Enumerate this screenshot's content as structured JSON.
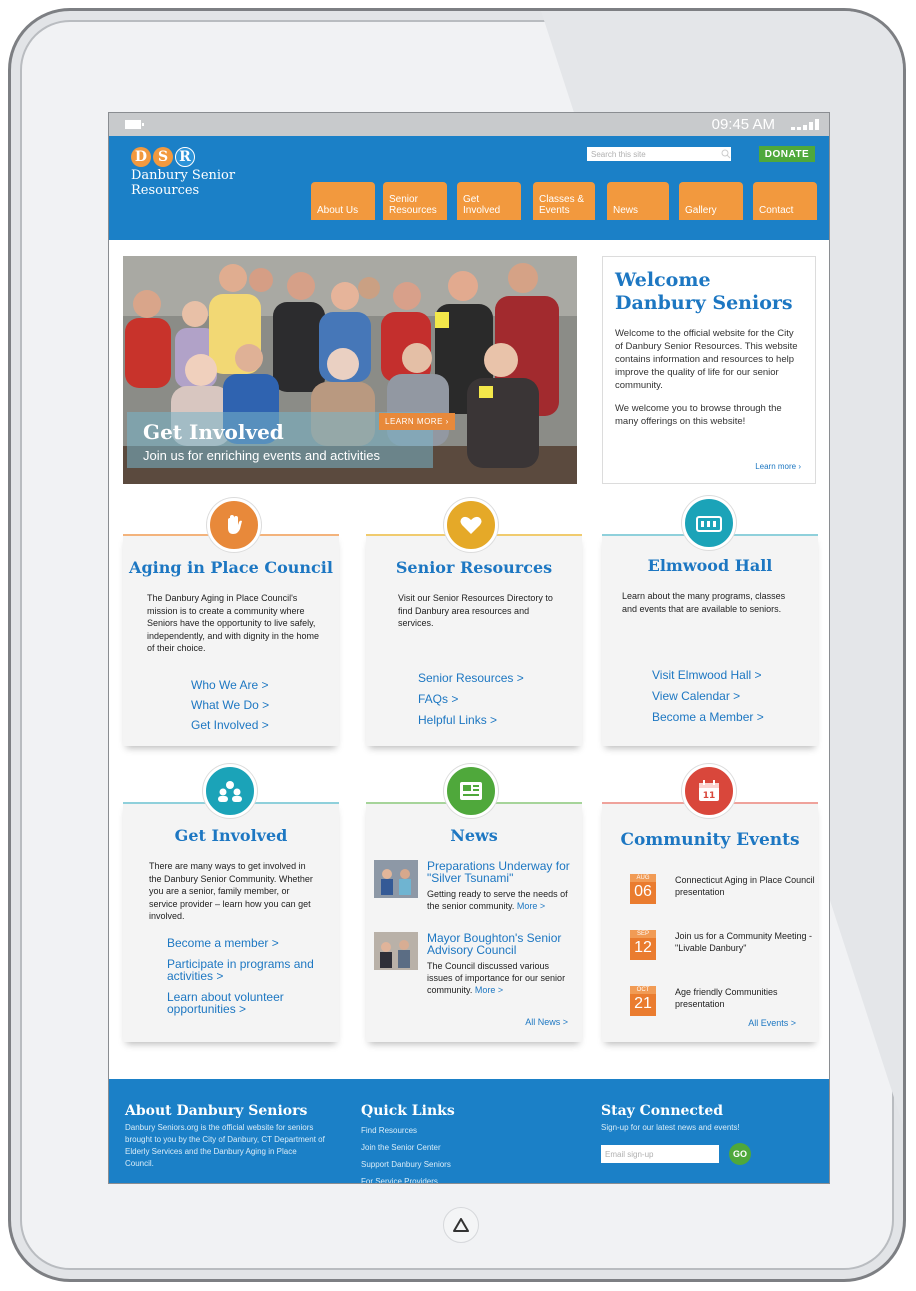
{
  "status_bar": {
    "time": "09:45 AM"
  },
  "logo": {
    "letters": [
      "D",
      "S",
      "R"
    ],
    "name_line1": "Danbury Senior",
    "name_line2": "Resources",
    "colors": [
      "#f2993e",
      "#f2993e",
      "#1b80c7"
    ]
  },
  "search": {
    "placeholder": "Search this site"
  },
  "donate_label": "DONATE",
  "nav": [
    {
      "label": "About Us"
    },
    {
      "label": "Senior Resources"
    },
    {
      "label": "Get Involved"
    },
    {
      "label": "Classes & Events"
    },
    {
      "label": "News"
    },
    {
      "label": "Gallery"
    },
    {
      "label": "Contact"
    }
  ],
  "hero": {
    "title": "Get Involved",
    "subtitle": "Join us for enriching events and activities",
    "button": "LEARN MORE ›"
  },
  "welcome": {
    "title": "Welcome Danbury Seniors",
    "p1": "Welcome to the official website for the City of Danbury Senior Resources. This website contains information and resources to help improve the quality of life for our senior community.",
    "p2": "We welcome you to browse through the many offerings on this website!",
    "link": "Learn more ›"
  },
  "cards": {
    "aging": {
      "title": "Aging in Place Council",
      "body": "The Danbury Aging in Place Council's mission is to create a community where Seniors  have the opportunity to live safely, independently, and with dignity in the home of their choice.",
      "links": [
        "Who We Are >",
        "What We Do >",
        "Get Involved >"
      ],
      "icon": "hand-icon",
      "color": "#e8893a"
    },
    "resources": {
      "title": "Senior Resources",
      "body": "Visit our Senior Resources Directory to find Danbury area resources and services.",
      "links": [
        "Senior Resources >",
        "FAQs >",
        "Helpful Links >"
      ],
      "icon": "heart-icon",
      "color": "#e5a928"
    },
    "elmwood": {
      "title": "Elmwood Hall",
      "body": "Learn about the many programs, classes and events that are available to seniors.",
      "links": [
        "Visit Elmwood Hall >",
        "View Calendar >",
        "Become a Member >"
      ],
      "icon": "building-icon",
      "color": "#1ba3b8"
    },
    "involved": {
      "title": "Get Involved",
      "body": "There are many ways to get involved in the Danbury Senior Community. Whether you are a senior, family member, or service provider – learn how you can get involved.",
      "links": [
        "Become a member >",
        "Participate in programs and activities >",
        "Learn about volunteer opportunities >"
      ],
      "icon": "people-icon",
      "color": "#1ba3b8"
    },
    "news": {
      "title": "News",
      "items": [
        {
          "title": "Preparations Underway for \"Silver Tsunami\"",
          "text": "Getting ready to serve the needs of the senior community.",
          "more": "More >"
        },
        {
          "title": "Mayor Boughton's Senior Advisory Council",
          "text": "The Council discussed various issues of importance for our senior community.",
          "more": "More >"
        }
      ],
      "all": "All News >",
      "icon": "newspaper-icon",
      "color": "#4fa83b"
    },
    "events": {
      "title": "Community Events",
      "items": [
        {
          "month": "AUG",
          "day": "06",
          "text": "Connecticut Aging in Place Council presentation"
        },
        {
          "month": "SEP",
          "day": "12",
          "text": "Join us for a Community Meeting - \"Livable Danbury\""
        },
        {
          "month": "OCT",
          "day": "21",
          "text": "Age friendly Communities presentation"
        }
      ],
      "all": "All Events >",
      "icon": "calendar-icon",
      "color": "#d9473b"
    }
  },
  "footer": {
    "about_title": "About Danbury Seniors",
    "about_text": "Danbury Seniors.org is the official website for seniors brought to you by the City of Danbury, CT Department of Elderly Services and the Danbury Aging in Place Council.",
    "quick_title": "Quick Links",
    "quick_links": [
      "Find Resources",
      "Join the Senior Center",
      "Support Danbury Seniors",
      "For Service Providers"
    ],
    "stay_title": "Stay Connected",
    "stay_text": "Sign-up for our latest news and events!",
    "email_placeholder": "Email sign-up",
    "go": "GO"
  }
}
